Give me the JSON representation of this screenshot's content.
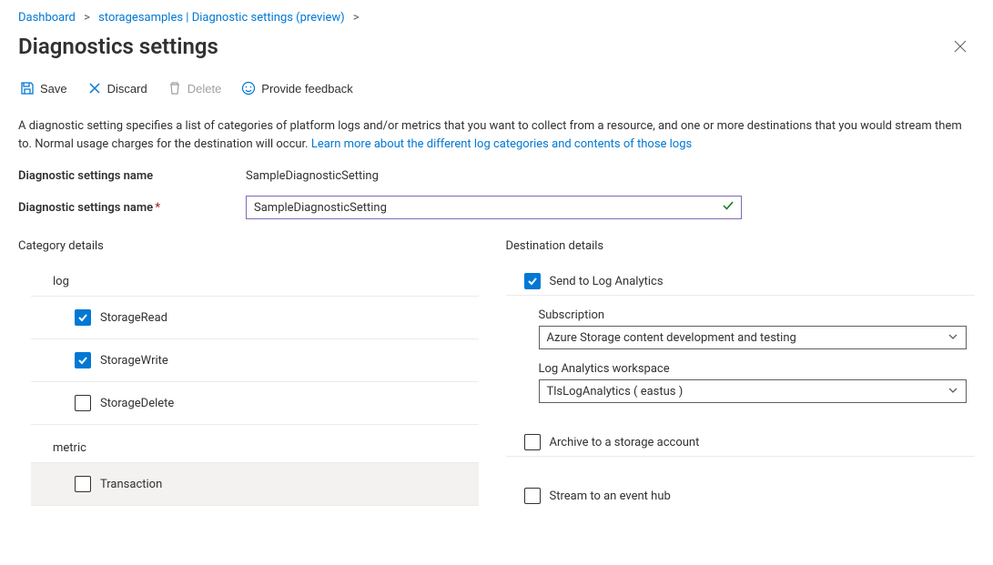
{
  "breadcrumb": {
    "items": [
      "Dashboard",
      "storagesamples | Diagnostic settings (preview)"
    ]
  },
  "page_title": "Diagnostics settings",
  "toolbar": {
    "save": "Save",
    "discard": "Discard",
    "delete": "Delete",
    "feedback": "Provide feedback"
  },
  "description": {
    "text": "A diagnostic setting specifies a list of categories of platform logs and/or metrics that you want to collect from a resource, and one or more destinations that you would stream them to. Normal usage charges for the destination will occur. ",
    "link": "Learn more about the different log categories and contents of those logs"
  },
  "name_label": "Diagnostic settings name",
  "name_value_display": "SampleDiagnosticSetting",
  "name_input_label": "Diagnostic settings name",
  "name_input_value": "SampleDiagnosticSetting",
  "category_title": "Category details",
  "destination_title": "Destination details",
  "log_section": "log",
  "metric_section": "metric",
  "logs": [
    {
      "label": "StorageRead",
      "checked": true
    },
    {
      "label": "StorageWrite",
      "checked": true
    },
    {
      "label": "StorageDelete",
      "checked": false
    }
  ],
  "metrics": [
    {
      "label": "Transaction",
      "checked": false
    }
  ],
  "destinations": {
    "log_analytics": {
      "label": "Send to Log Analytics",
      "checked": true
    },
    "storage": {
      "label": "Archive to a storage account",
      "checked": false
    },
    "event_hub": {
      "label": "Stream to an event hub",
      "checked": false
    }
  },
  "subscription": {
    "label": "Subscription",
    "value": "Azure Storage content development and testing"
  },
  "workspace": {
    "label": "Log Analytics workspace",
    "value": "TlsLogAnalytics ( eastus )"
  }
}
